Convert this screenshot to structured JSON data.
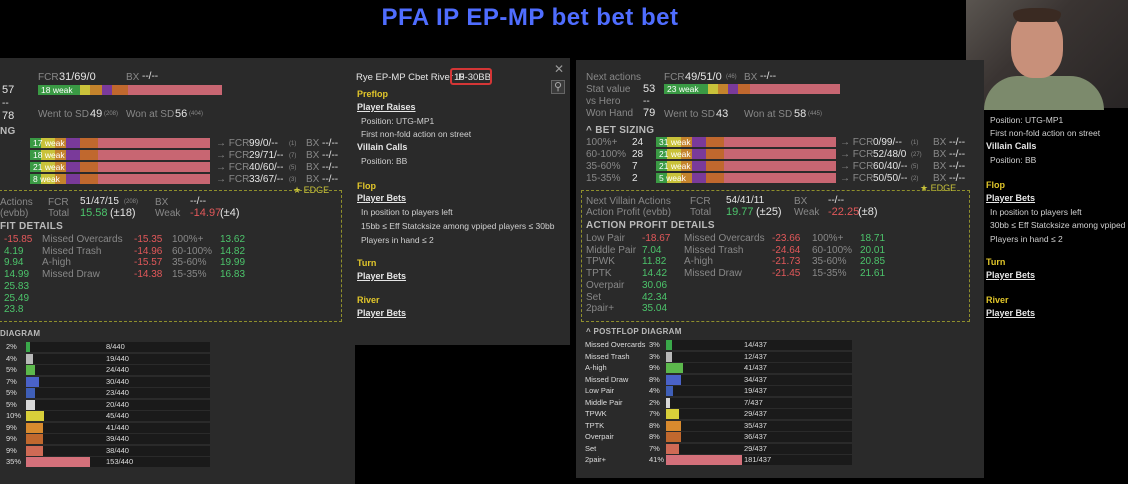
{
  "title": "PFA IP EP-MP bet bet bet",
  "left": {
    "top": {
      "v57": "57",
      "dash": "--",
      "v78": "78",
      "fcr": "FCR",
      "fcrv": "31/69/0",
      "bx": "BX",
      "bxv": "--/--",
      "weak": "18 weak",
      "sd": "Went to SD",
      "sdv": "49",
      "sdsmall": "(208)",
      "won": "Won at SD",
      "wonv": "56",
      "wonsmall": "(404)"
    },
    "ng": "NG",
    "sizing": [
      {
        "w": "17 weak",
        "fcr": "99/0/--",
        "fcrs": "(1)",
        "bx": "--/--"
      },
      {
        "w": "18 weak",
        "fcr": "29/71/--",
        "fcrs": "(7)",
        "bx": "--/--"
      },
      {
        "w": "21 weak",
        "fcr": "40/60/--",
        "fcrs": "(5)",
        "bx": "--/--"
      },
      {
        "w": "8 weak",
        "fcr": "33/67/--",
        "fcrs": "(3)",
        "bx": "--/--"
      }
    ],
    "arrow": "→ FCR",
    "bxl": "BX",
    "edge": "★ EDGE",
    "actions": {
      "a1": "Actions",
      "a2": "(evbb)",
      "fcr": "FCR",
      "fcrv": "51/47/15",
      "fcrs": "(208)",
      "bx": "BX",
      "bxv": "--/--",
      "total": "Total",
      "totalv": "15.58",
      "totalp": "(±18)",
      "weak": "Weak",
      "weakv": "-14.97",
      "weakp": "(±4)"
    },
    "profit_hdr": "FIT DETAILS",
    "col1": [
      "-15.85",
      "4.19",
      "9.94",
      "14.99",
      "25.83",
      "25.49",
      "23.8"
    ],
    "col2": [
      {
        "l": "Missed Overcards",
        "v": "-15.35"
      },
      {
        "l": "Missed Trash",
        "v": "-14.96"
      },
      {
        "l": "A-high",
        "v": "-15.57"
      },
      {
        "l": "Missed Draw",
        "v": "-14.38"
      }
    ],
    "col3": [
      {
        "l": "100%+",
        "v": "13.62"
      },
      {
        "l": "60-100%",
        "v": "14.82"
      },
      {
        "l": "35-60%",
        "v": "19.99"
      },
      {
        "l": "15-35%",
        "v": "16.83"
      }
    ],
    "diag_hdr": "DIAGRAM",
    "diag": [
      {
        "p": "2%",
        "c": "8/440",
        "f": 0.02
      },
      {
        "p": "4%",
        "c": "19/440",
        "f": 0.04
      },
      {
        "p": "5%",
        "c": "24/440",
        "f": 0.05
      },
      {
        "p": "7%",
        "c": "30/440",
        "f": 0.07
      },
      {
        "p": "5%",
        "c": "23/440",
        "f": 0.05
      },
      {
        "p": "5%",
        "c": "20/440",
        "f": 0.05
      },
      {
        "p": "10%",
        "c": "45/440",
        "f": 0.1
      },
      {
        "p": "9%",
        "c": "41/440",
        "f": 0.09
      },
      {
        "p": "9%",
        "c": "39/440",
        "f": 0.09
      },
      {
        "p": "9%",
        "c": "38/440",
        "f": 0.09
      },
      {
        "p": "35%",
        "c": "153/440",
        "f": 0.35
      }
    ]
  },
  "mid": {
    "head": "Rye EP-MP Cbet River IP",
    "range": "15-30BB",
    "preflop": "Preflop",
    "pr": "Player Raises",
    "pos": "Position: UTG-MP1",
    "fna": "First non-fold action on street",
    "vc": "Villain Calls",
    "vpos": "Position: BB",
    "flop": "Flop",
    "pb": "Player Bets",
    "ip": "In position to players left",
    "eff": "15bb ≤ Eff Statcksize among vpiped players ≤ 30bb",
    "hand": "Players in hand ≤ 2",
    "turn": "Turn",
    "tpb": "Player Bets",
    "river": "River",
    "rpb": "Player Bets"
  },
  "right": {
    "na": "Next actions",
    "sv": "Stat value",
    "vh": "vs Hero",
    "wh": "Won Hand",
    "svv": "53",
    "vhv": "--",
    "whv": "79",
    "fcr": "FCR",
    "fcrv": "49/51/0",
    "fcrs": "(46)",
    "bx": "BX",
    "bxv": "--/--",
    "weak": "23 weak",
    "sd": "Went to SD",
    "sdv": "43",
    "won": "Won at SD",
    "wonv": "58",
    "wons": "(445)",
    "bs": "BET SIZING",
    "sizing": [
      {
        "p": "100%+",
        "n": "24",
        "w": "31 weak",
        "fcr": "0/99/--",
        "fcrs": "(1)",
        "bx": "--/--"
      },
      {
        "p": "60-100%",
        "n": "28",
        "w": "21 weak",
        "fcr": "52/48/0",
        "fcrs": "(27)",
        "bx": "--/--"
      },
      {
        "p": "35-60%",
        "n": "7",
        "w": "21 weak",
        "fcr": "60/40/--",
        "fcrs": "(5)",
        "bx": "--/--"
      },
      {
        "p": "15-35%",
        "n": "2",
        "w": "5 weak",
        "fcr": "50/50/--",
        "fcrs": "(2)",
        "bx": "--/--"
      }
    ],
    "arrow": "→ FCR",
    "bxl": "BX",
    "edge": "★ EDGE",
    "nva": "Next Villain Actions",
    "ap": "Action Profit (evbb)",
    "fcr2": "FCR",
    "fcr2v": "54/41/11",
    "bx2": "BX",
    "bx2v": "--/--",
    "total": "Total",
    "totalv": "19.77",
    "totalp": "(±25)",
    "weakl": "Weak",
    "weakv": "-22.25",
    "weakp": "(±8)",
    "apd": "ACTION PROFIT DETAILS",
    "c1": [
      {
        "l": "Low Pair",
        "v": "-18.67"
      },
      {
        "l": "Middle Pair",
        "v": "7.04"
      },
      {
        "l": "TPWK",
        "v": "11.82"
      },
      {
        "l": "TPTK",
        "v": "14.42"
      },
      {
        "l": "Overpair",
        "v": "30.06"
      },
      {
        "l": "Set",
        "v": "42.34"
      },
      {
        "l": "2pair+",
        "v": "35.04"
      }
    ],
    "c2": [
      {
        "l": "Missed Overcards",
        "v": "-23.66"
      },
      {
        "l": "Missed Trash",
        "v": "-24.64"
      },
      {
        "l": "A-high",
        "v": "-21.73"
      },
      {
        "l": "Missed Draw",
        "v": "-21.45"
      }
    ],
    "c3": [
      {
        "l": "100%+",
        "v": "18.71"
      },
      {
        "l": "60-100%",
        "v": "20.01"
      },
      {
        "l": "35-60%",
        "v": "20.85"
      },
      {
        "l": "15-35%",
        "v": "21.61"
      }
    ],
    "pd": "POSTFLOP DIAGRAM",
    "diag": [
      {
        "l": "Missed Overcards",
        "p": "3%",
        "c": "14/437",
        "f": 0.03
      },
      {
        "l": "Missed Trash",
        "p": "3%",
        "c": "12/437",
        "f": 0.03
      },
      {
        "l": "A-high",
        "p": "9%",
        "c": "41/437",
        "f": 0.09
      },
      {
        "l": "Missed Draw",
        "p": "8%",
        "c": "34/437",
        "f": 0.08
      },
      {
        "l": "Low Pair",
        "p": "4%",
        "c": "19/437",
        "f": 0.04
      },
      {
        "l": "Middle Pair",
        "p": "2%",
        "c": "7/437",
        "f": 0.02
      },
      {
        "l": "TPWK",
        "p": "7%",
        "c": "29/437",
        "f": 0.07
      },
      {
        "l": "TPTK",
        "p": "8%",
        "c": "35/437",
        "f": 0.08
      },
      {
        "l": "Overpair",
        "p": "8%",
        "c": "36/437",
        "f": 0.08
      },
      {
        "l": "Set",
        "p": "7%",
        "c": "29/437",
        "f": 0.07
      },
      {
        "l": "2pair+",
        "p": "41%",
        "c": "181/437",
        "f": 0.41
      }
    ]
  },
  "side": {
    "pos": "Position: UTG-MP1",
    "fna": "First non-fold action on street",
    "vc": "Villain Calls",
    "vpos": "Position: BB",
    "flop": "Flop",
    "pb": "Player Bets",
    "ip": "In position to players left",
    "eff": "30bb ≤ Eff Statcksize among vpiped",
    "hand": "Players in hand ≤ 2",
    "turn": "Turn",
    "tpb": "Player Bets",
    "river": "River",
    "rpb": "Player Bets"
  },
  "colors": {
    "diag": [
      "#3aa84a",
      "#b8b8b8",
      "#5cb84c",
      "#4a62c8",
      "#3f5fb8",
      "#d8d8d8",
      "#d8cf3a",
      "#d88a2e",
      "#c0682e",
      "#cf6a55",
      "#d4707a"
    ]
  }
}
